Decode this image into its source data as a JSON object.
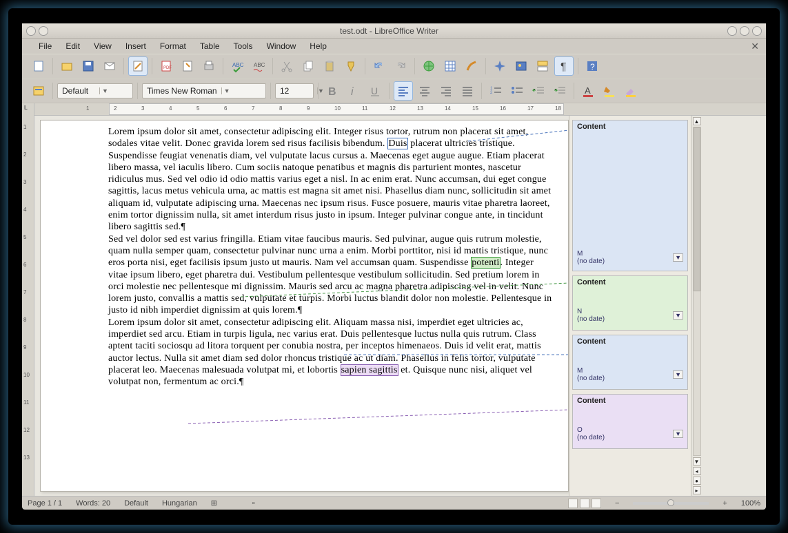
{
  "title": "test.odt - LibreOffice Writer",
  "menu": {
    "file": "File",
    "edit": "Edit",
    "view": "View",
    "insert": "Insert",
    "format": "Format",
    "table": "Table",
    "tools": "Tools",
    "window": "Window",
    "help": "Help"
  },
  "style_dropdown": "Default",
  "font_dropdown": "Times New Roman",
  "size_dropdown": "12",
  "ruler_h": [
    "1",
    "2",
    "3",
    "4",
    "5",
    "6",
    "7",
    "8",
    "9",
    "10",
    "11",
    "12",
    "13",
    "14",
    "15",
    "16",
    "17",
    "18"
  ],
  "ruler_v": [
    "1",
    "2",
    "3",
    "4",
    "5",
    "6",
    "7",
    "8",
    "9",
    "10",
    "11",
    "12",
    "13"
  ],
  "paragraphs": {
    "p1a": "Lorem ipsum dolor sit amet, consectetur adipiscing elit. Integer risus tortor, rutrum non placerat sit amet, sodales vitae velit. Donec gravida lorem sed risus facilisis bibendum. ",
    "p1_hl": "Duis",
    "p1b": " placerat ultricies tristique. Suspendisse feugiat venenatis diam, vel vulputate lacus cursus a. Maecenas eget augue augue. Etiam placerat libero massa, vel iaculis libero. Cum sociis natoque penatibus et magnis dis parturient montes, nascetur ridiculus mus. Sed vel odio id odio mattis varius eget a nisl. In ac enim erat. Nunc accumsan, dui eget congue sagittis, lacus metus vehicula urna, ac mattis est magna sit amet nisi. Phasellus diam nunc, sollicitudin sit amet aliquam id, vulputate adipiscing urna. Maecenas nec ipsum risus. Fusce posuere, mauris vitae pharetra laoreet, enim tortor dignissim nulla, sit amet interdum risus justo in ipsum. Integer pulvinar congue ante, in tincidunt libero sagittis sed.¶",
    "p2a": "Sed vel dolor sed est varius fringilla. Etiam vitae faucibus mauris. Sed pulvinar, augue quis rutrum molestie, quam nulla semper quam, consectetur pulvinar nunc urna a enim. Morbi porttitor, nisi id mattis tristique, nunc eros porta nisi, eget facilisis ipsum justo ut mauris. Nam vel accumsan quam. Suspendisse ",
    "p2_hl": "potenti",
    "p2b": ". Integer vitae ipsum libero, eget pharetra dui. Vestibulum pellentesque vestibulum sollicitudin. Sed pretium lorem in orci molestie nec pellentesque mi dignissim. Mauris sed arcu ac magna pharetra adipiscing vel in velit. Nunc lorem justo, convallis a mattis sed, vulputate et turpis. Morbi luctus blandit dolor non molestie. Pellentesque in justo id nibh imperdiet dignissim at quis lorem.¶",
    "p3a": "Lorem ipsum dolor sit amet, consectetur adipiscing elit. Aliquam massa nisi, imperdiet eget ultricies ac, imperdiet sed arcu. Etiam in turpis ligula, nec varius erat. Duis pellentesque luctus nulla quis rutrum. Class aptent taciti sociosqu ad litora torquent per conubia nostra, per inceptos himenaeos. Duis id velit erat, mattis auctor lectus. Nulla sit amet diam sed dolor rhoncus tristique ac ut diam. Phasellus in felis tortor, vulputate placerat leo. Maecenas malesuada volutpat mi, et lobortis ",
    "p3_hl": "sapien sagittis",
    "p3b": " et. Quisque nunc nisi, aliquet vel volutpat non, fermentum ac orci.¶"
  },
  "comments": [
    {
      "header": "Content",
      "author": "M",
      "date": "(no date)",
      "color": "blue"
    },
    {
      "header": "Content",
      "author": "N",
      "date": "(no date)",
      "color": "green"
    },
    {
      "header": "Content",
      "author": "M",
      "date": "(no date)",
      "color": "blue"
    },
    {
      "header": "Content",
      "author": "O",
      "date": "(no date)",
      "color": "purple"
    }
  ],
  "status": {
    "page": "Page 1 / 1",
    "words": "Words: 20",
    "style": "Default",
    "lang": "Hungarian",
    "zoom": "100%"
  }
}
